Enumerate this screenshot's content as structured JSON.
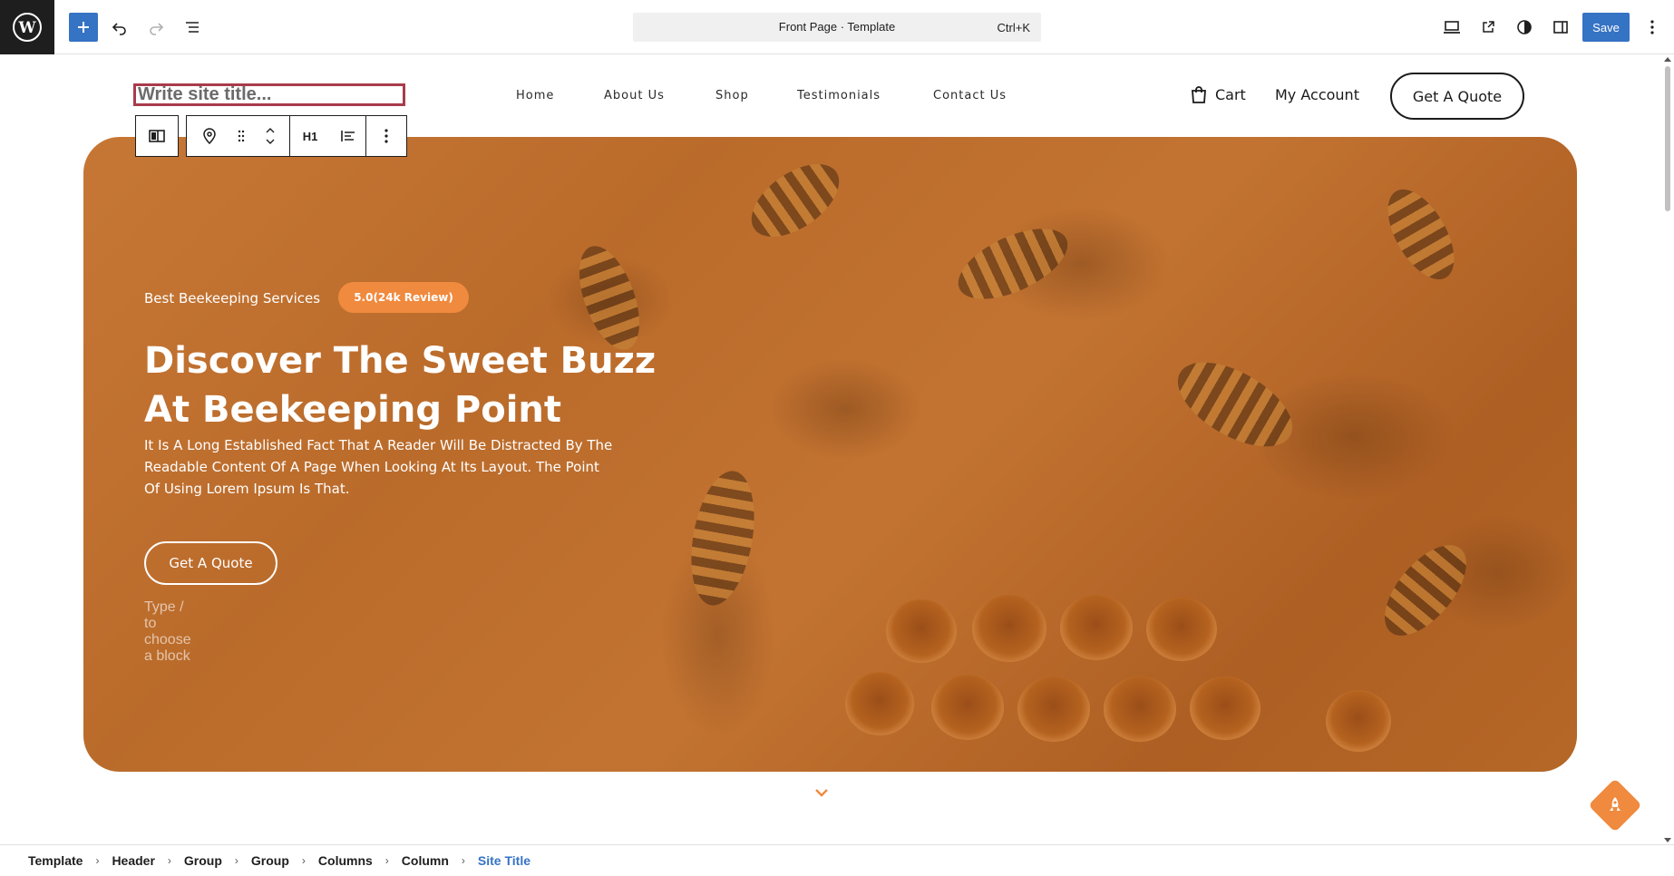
{
  "topbar": {
    "document_title": "Front Page · Template",
    "shortcut": "Ctrl+K",
    "save_label": "Save"
  },
  "site": {
    "title_placeholder": "Write site title...",
    "nav": [
      "Home",
      "About Us",
      "Shop",
      "Testimonials",
      "Contact Us"
    ],
    "cart_label": "Cart",
    "account_label": "My Account",
    "quote_label": "Get A Quote"
  },
  "block_toolbar": {
    "heading_level": "H1"
  },
  "hero": {
    "tagline": "Best Beekeeping Services",
    "rating": "5.0(24k Review)",
    "heading_line1": "Discover The Sweet Buzz",
    "heading_line2": "At Beekeeping Point",
    "paragraph": "It Is A Long Established Fact That A Reader Will Be Distracted By The Readable Content Of A Page When Looking At Its Layout. The Point Of Using Lorem Ipsum Is That.",
    "button_label": "Get A Quote",
    "block_placeholder": "Type / to choose a block"
  },
  "breadcrumb": [
    "Template",
    "Header",
    "Group",
    "Group",
    "Columns",
    "Column",
    "Site Title"
  ],
  "colors": {
    "accent": "#f08a3e",
    "admin_blue": "#3573c4",
    "selection": "#a93b4c"
  }
}
